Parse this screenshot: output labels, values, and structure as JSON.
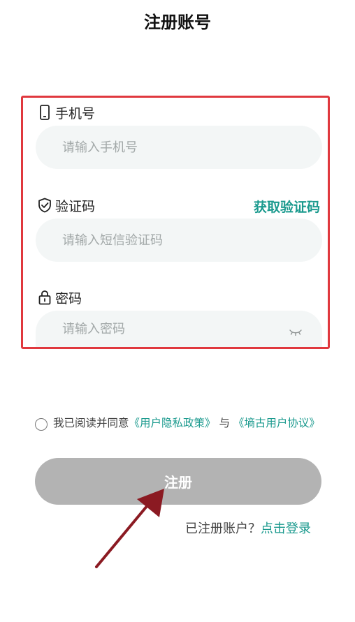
{
  "page": {
    "title": "注册账号"
  },
  "form": {
    "phone": {
      "label": "手机号",
      "placeholder": "请输入手机号",
      "icon": "phone-icon"
    },
    "code": {
      "label": "验证码",
      "placeholder": "请输入短信验证码",
      "get_code_label": "获取验证码",
      "icon": "shield-icon"
    },
    "password": {
      "label": "密码",
      "placeholder": "请输入密码",
      "icon": "lock-icon",
      "toggle_icon": "eye-closed-icon"
    }
  },
  "agreement": {
    "prefix": "我已阅读并同意",
    "privacy_link": "《用户隐私政策》",
    "middle": "与",
    "terms_link": "《墒古用户协议》",
    "checked": false
  },
  "register_button": {
    "label": "注册"
  },
  "login": {
    "prompt": "已注册账户？",
    "link": "点击登录"
  },
  "colors": {
    "accent": "#1b9a8e",
    "highlight_box": "#e0383e",
    "button_disabled": "#b3b3b3",
    "arrow": "#8b1a22"
  }
}
